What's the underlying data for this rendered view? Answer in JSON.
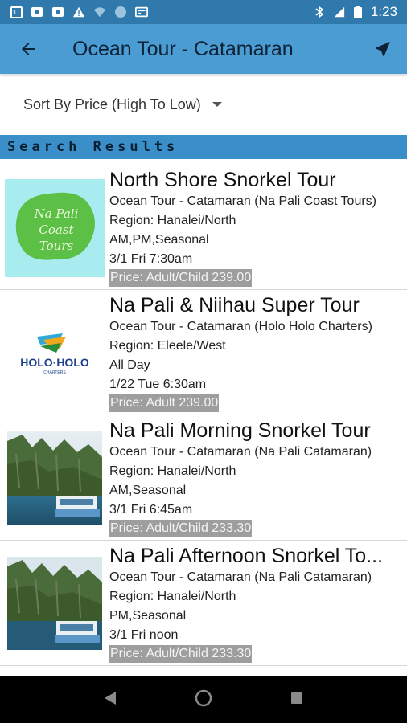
{
  "status_bar": {
    "calendar_day": "31",
    "network": "LTE",
    "time": "1:23"
  },
  "app_bar": {
    "title": "Ocean Tour - Catamaran"
  },
  "sort": {
    "selected": "Sort By Price (High To Low)"
  },
  "section": {
    "header": "Search Results"
  },
  "results": [
    {
      "title": "North Shore Snorkel Tour",
      "category": "Ocean Tour - Catamaran (Na Pali Coast Tours)",
      "region": "Region: Hanalei/North",
      "times": "AM,PM,Seasonal",
      "date": "3/1 Fri 7:30am",
      "price": "Price: Adult/Child 239.00",
      "thumb": "na-pali-coast-tours-logo",
      "thumb_text": [
        "Na Pali",
        "Coast",
        "Tours"
      ]
    },
    {
      "title": "Na Pali & Niihau Super Tour",
      "category": "Ocean Tour - Catamaran (Holo Holo Charters)",
      "region": "Region: Eleele/West",
      "times": "All Day",
      "date": "1/22 Tue 6:30am",
      "price": "Price: Adult 239.00",
      "thumb": "holo-holo-logo",
      "thumb_text": [
        "HOLO·HOLO",
        "CHARTERS"
      ]
    },
    {
      "title": "Na Pali Morning Snorkel Tour",
      "category": "Ocean Tour - Catamaran (Na Pali Catamaran)",
      "region": "Region: Hanalei/North",
      "times": "AM,Seasonal",
      "date": "3/1 Fri 6:45am",
      "price": "Price: Adult/Child 233.30",
      "thumb": "na-pali-coast-photo"
    },
    {
      "title": "Na Pali Afternoon Snorkel To...",
      "category": "Ocean Tour - Catamaran (Na Pali Catamaran)",
      "region": "Region: Hanalei/North",
      "times": "PM,Seasonal",
      "date": "3/1 Fri noon",
      "price": "Price: Adult/Child 233.30",
      "thumb": "na-pali-coast-photo"
    }
  ],
  "colors": {
    "status_bar": "#2f79ac",
    "app_bar": "#4b9cd3",
    "section_header": "#3b8fc9",
    "price_bg": "#9e9e9e"
  }
}
